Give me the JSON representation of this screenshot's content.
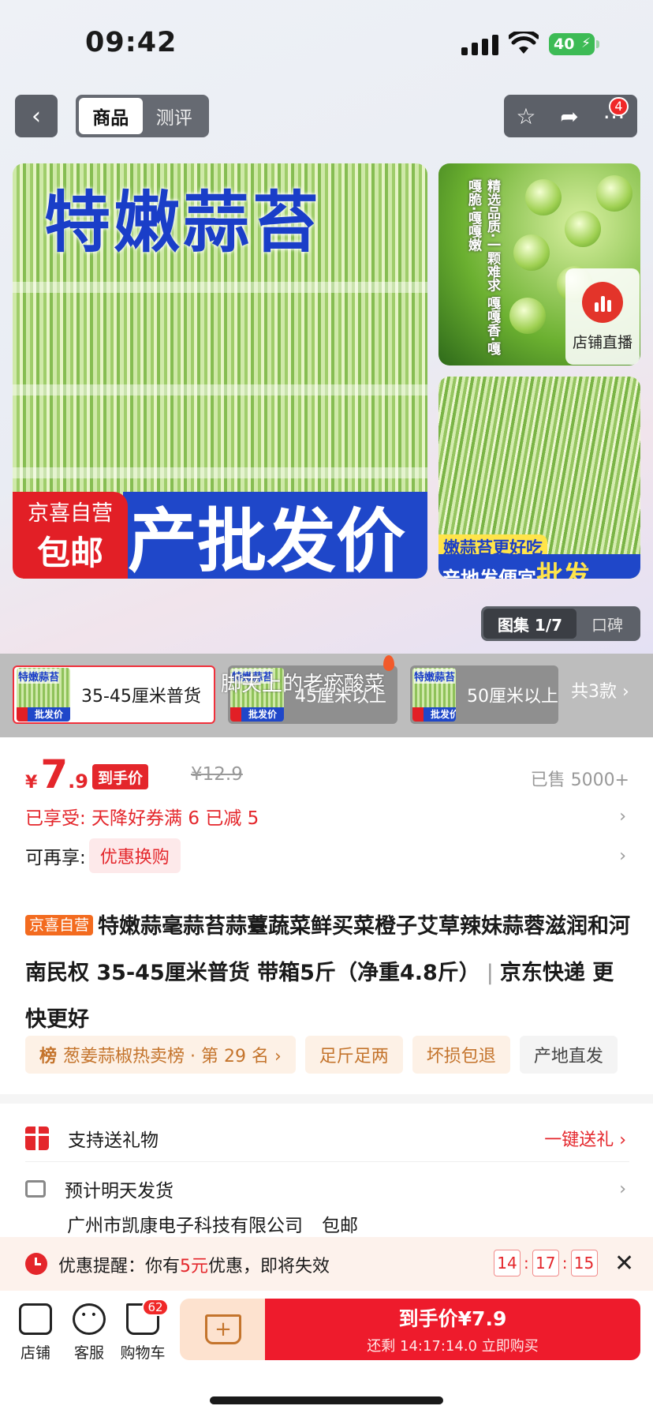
{
  "status": {
    "time": "09:42",
    "battery": "40"
  },
  "nav": {
    "back_icon": "chevron-left-icon",
    "tabs": [
      {
        "label": "商品",
        "active": true
      },
      {
        "label": "测评",
        "active": false
      }
    ],
    "actions": [
      "star-icon",
      "share-icon",
      "more-icon"
    ],
    "more_badge": "4"
  },
  "hero": {
    "main_title": "特嫩蒜苔",
    "main_bottom_text": "产批发价",
    "self_run_line1": "京喜自营",
    "self_run_line2": "包邮",
    "side1_text": "精选品质·一颗难求 嘎嘎香·嘎嘎脆·嘎嘎嫩",
    "live_label": "店铺直播",
    "side2_tag1": "嫩蒜苔更好吃",
    "side2_tag2_prefix": "产地发便宜",
    "side2_tag2_emph": "批发",
    "gallery_label": "图集 1/7",
    "reviews_label": "口碑"
  },
  "variants": {
    "items": [
      {
        "label": "35-45厘米普货",
        "selected": true
      },
      {
        "label": "45厘米以上",
        "selected": false
      },
      {
        "label": "50厘米以上",
        "selected": false
      }
    ],
    "thumb_top": "特嫩蒜苔",
    "thumb_bottom": "批发价",
    "count": "共3款 ›",
    "overlay_text": "脚夹上的老瘀酸菜"
  },
  "price": {
    "currency": "¥",
    "int": "7",
    "dec": ".9",
    "tag": "到手价",
    "original": "¥12.9",
    "sold": "已售 5000+"
  },
  "promos": {
    "enjoyed": "已享受: 天降好券满 6 已减 5",
    "more_label": "可再享:",
    "more_pill": "优惠换购"
  },
  "product": {
    "self_run_tag": "京喜自营",
    "title": "特嫩蒜毫蒜苔蒜薹蔬菜鲜买菜橙子艾草辣妹蒜蓉滋润和河南民权 35-45厘米普货 带箱5斤（净重4.8斤）",
    "sep": "|",
    "suffix": "京东快递 更快更好"
  },
  "tags": [
    {
      "rank_prefix": "榜",
      "label": "葱姜蒜椒热卖榜 · 第 29 名 ›"
    },
    {
      "label": "足斤足两"
    },
    {
      "label": "坏损包退"
    },
    {
      "label": "产地直发"
    }
  ],
  "services": {
    "gift_label": "支持送礼物",
    "gift_action": "一键送礼 ›",
    "ship_label": "预计明天发货",
    "seller": "广州市凯康电子科技有限公司",
    "free_ship": "包邮"
  },
  "reminder": {
    "prefix": "优惠提醒：你有",
    "amount": "5元",
    "suffix": "优惠，即将失效",
    "hh": "14",
    "mm": "17",
    "ss": "15",
    "close": "✕"
  },
  "bottom": {
    "store": "店铺",
    "service": "客服",
    "cart": "购物车",
    "cart_badge": "62",
    "buy_main": "到手价¥7.9",
    "buy_sub": "还剩 14:17:14.0 立即购买"
  },
  "colors": {
    "accent": "#e4262b",
    "buy": "#ee1b2c",
    "orange": "#c4742c",
    "blue": "#1f47c9"
  }
}
